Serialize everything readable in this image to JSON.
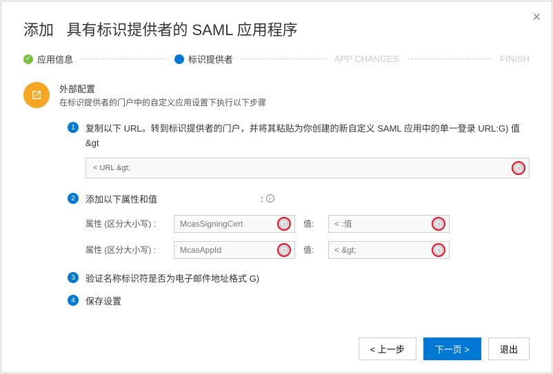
{
  "title_prefix": "添加",
  "title_main": "具有标识提供者的 SAML 应用程序",
  "close_glyph": "×",
  "steps": {
    "s1": "应用信息",
    "s2": "标识提供者",
    "s3": "APP CHANGES",
    "s4": "FINISH",
    "check_glyph": "✓"
  },
  "external": {
    "title": "外部配置",
    "desc": "在标识提供者的门户中的自定义应用设置下执行以下步骤"
  },
  "step1": {
    "text": "复制以下 URL。转到标识提供者的门户，并将其粘贴为你创建的新自定义 SAML 应用中的单一登录 URL:G) 值 &gt",
    "url_value": "< URL &gt;"
  },
  "step2": {
    "text": "添加以下属性和值",
    "colon_text": ":",
    "attr_label": "属性 (区分大小写) :",
    "val_label": "值:",
    "row1_attr": "McasSigningCert",
    "row1_val": "< :值",
    "row2_attr": "McasAppId",
    "row2_val": "< &gt;"
  },
  "step3": {
    "text": "验证名称标识符是否为电子邮件地址格式 G)"
  },
  "step4": {
    "text": "保存设置"
  },
  "buttons": {
    "prev": "< 上一步",
    "next": "下一页 >",
    "exit": "退出"
  }
}
